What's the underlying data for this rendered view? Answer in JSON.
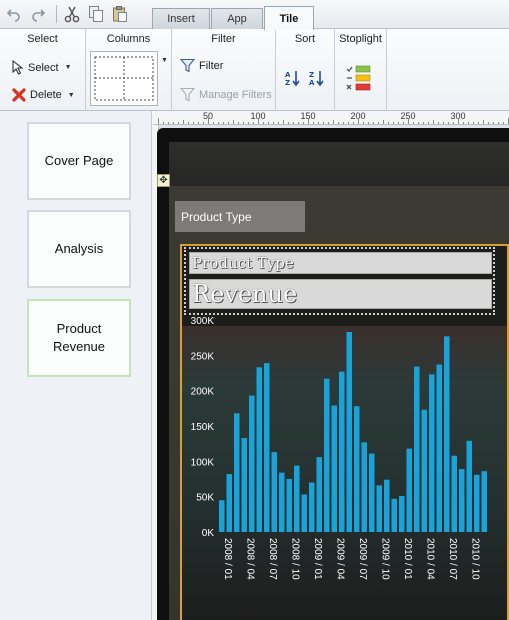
{
  "toolbar": {
    "icons": [
      "undo-icon",
      "redo-icon",
      "cut-icon",
      "copy-icon",
      "paste-icon"
    ]
  },
  "tabs": [
    {
      "label": "Insert",
      "active": false
    },
    {
      "label": "App",
      "active": false
    },
    {
      "label": "Tile",
      "active": true
    }
  ],
  "ribbon": {
    "select": {
      "header": "Select",
      "select_label": "Select",
      "delete_label": "Delete"
    },
    "columns": {
      "header": "Columns"
    },
    "filter": {
      "header": "Filter",
      "filter_label": "Filter",
      "manage_label": "Manage Filters"
    },
    "sort": {
      "header": "Sort"
    },
    "stoplight": {
      "header": "Stoplight"
    }
  },
  "pages": [
    {
      "label": "Cover Page",
      "selected": false
    },
    {
      "label": "Analysis",
      "selected": false
    },
    {
      "label": "Product Revenue",
      "selected": true
    }
  ],
  "ruler": {
    "labels": [
      "50",
      "100",
      "150",
      "200",
      "250",
      "300"
    ]
  },
  "dashboard": {
    "dropdown_label": "Product Type",
    "tile_title": "Product Type",
    "tile_subtitle": "Revenue"
  },
  "colors": {
    "bar": "#1aa3d8",
    "tile_border": "#d9a02a",
    "device": "#0f0f10"
  },
  "chart_data": {
    "type": "bar",
    "title": "",
    "ylim": [
      0,
      300000
    ],
    "yticks": [
      "0K",
      "50K",
      "100K",
      "150K",
      "200K",
      "250K",
      "300K"
    ],
    "x_tick_labels": [
      "2008 / 01",
      "2008 / 04",
      "2008 / 07",
      "2008 / 10",
      "2009 / 01",
      "2009 / 04",
      "2009 / 07",
      "2009 / 10",
      "2010 / 01",
      "2010 / 04",
      "2010 / 07",
      "2010 / 10"
    ],
    "categories": [
      "2008 / 01",
      "2008 / 02",
      "2008 / 03",
      "2008 / 04",
      "2008 / 05",
      "2008 / 06",
      "2008 / 07",
      "2008 / 08",
      "2008 / 09",
      "2008 / 10",
      "2008 / 11",
      "2008 / 12",
      "2009 / 01",
      "2009 / 02",
      "2009 / 03",
      "2009 / 04",
      "2009 / 05",
      "2009 / 06",
      "2009 / 07",
      "2009 / 08",
      "2009 / 09",
      "2009 / 10",
      "2009 / 11",
      "2009 / 12",
      "2010 / 01",
      "2010 / 02",
      "2010 / 03",
      "2010 / 04",
      "2010 / 05",
      "2010 / 06",
      "2010 / 07",
      "2010 / 08",
      "2010 / 09",
      "2010 / 10",
      "2010 / 11",
      "2010 / 12"
    ],
    "values": [
      45000,
      82000,
      168000,
      133000,
      193000,
      233000,
      239000,
      113000,
      84000,
      75000,
      94000,
      53000,
      70000,
      106000,
      217000,
      179000,
      227000,
      283000,
      178000,
      127000,
      111000,
      66000,
      74000,
      47000,
      51000,
      118000,
      234000,
      173000,
      223000,
      237000,
      277000,
      108000,
      89000,
      129000,
      81000,
      86000
    ],
    "grid": false,
    "legend": "none"
  }
}
